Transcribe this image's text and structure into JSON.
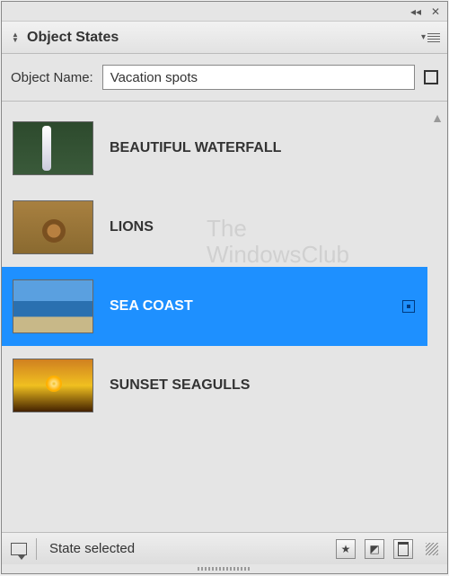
{
  "panel": {
    "title": "Object States",
    "collapse_tooltip": "Collapse",
    "close_tooltip": "Close",
    "flyout_tooltip": "Panel menu"
  },
  "object_name": {
    "label": "Object Name:",
    "value": "Vacation spots"
  },
  "states": [
    {
      "label": "BEAUTIFUL WATERFALL",
      "thumb": "waterfall",
      "selected": false
    },
    {
      "label": "LIONS",
      "thumb": "lions",
      "selected": false
    },
    {
      "label": "SEA COAST",
      "thumb": "sea",
      "selected": true
    },
    {
      "label": "SUNSET SEAGULLS",
      "thumb": "sunset",
      "selected": false
    }
  ],
  "footer": {
    "status": "State selected",
    "preview": "Preview",
    "convert": "★",
    "new": "New State",
    "delete": "Delete State"
  },
  "watermark": {
    "line1": "The",
    "line2": "WindowsClub"
  }
}
